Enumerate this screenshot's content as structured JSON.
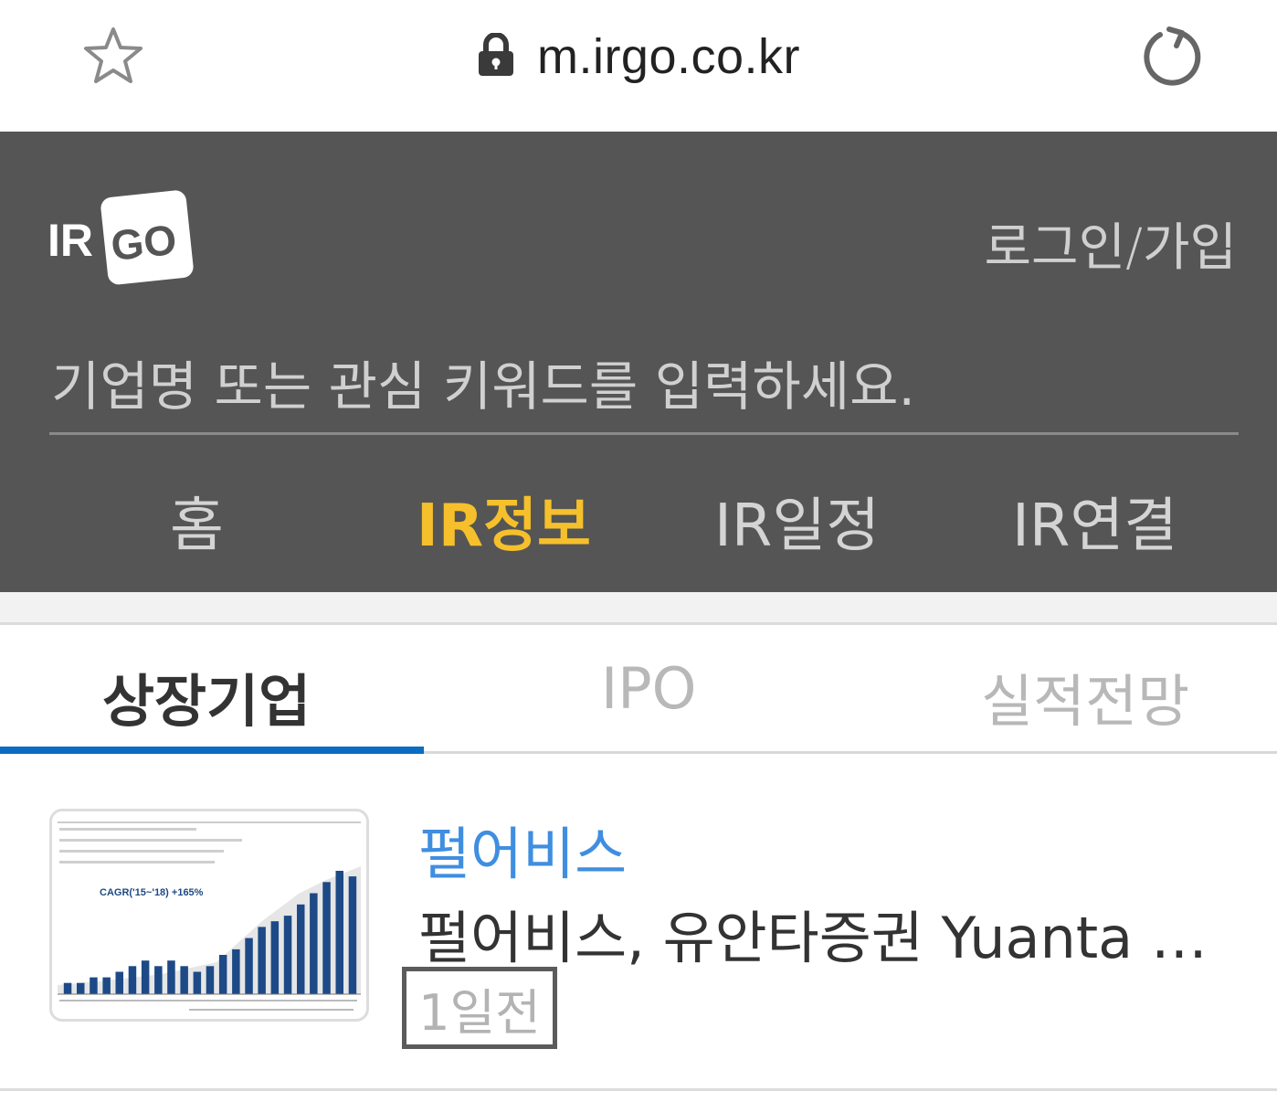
{
  "browser": {
    "url": "m.irgo.co.kr",
    "icons": [
      "star-icon",
      "lock-icon",
      "reload-icon"
    ]
  },
  "header": {
    "logo": "IR GO",
    "login_label": "로그인/가입",
    "search_placeholder": "기업명 또는 관심 키워드를 입력하세요.",
    "nav": [
      {
        "label": "홈",
        "active": false
      },
      {
        "label": "IR정보",
        "active": true
      },
      {
        "label": "IR일정",
        "active": false
      },
      {
        "label": "IR연결",
        "active": false
      }
    ]
  },
  "sub_tabs": [
    {
      "label": "상장기업",
      "active": true
    },
    {
      "label": "IPO",
      "active": false
    },
    {
      "label": "실적전망",
      "active": false
    }
  ],
  "list": [
    {
      "company": "펄어비스",
      "headline": "펄어비스, 유안타증권 Yuanta Korea 기업설명회",
      "time": "1일전"
    }
  ],
  "thumbnail": {
    "cagr": "CAGR('15~'18) +165%",
    "bars": [
      2,
      2,
      3,
      3,
      4,
      5,
      6,
      5,
      6,
      5,
      4,
      5,
      7,
      8,
      10,
      12,
      13,
      14,
      16,
      18,
      20,
      22,
      21
    ]
  },
  "colors": {
    "header_bg": "#555555",
    "nav_active": "#f5c02b",
    "tab_underline": "#0a6cc2",
    "company_link": "#3f8ee0"
  }
}
